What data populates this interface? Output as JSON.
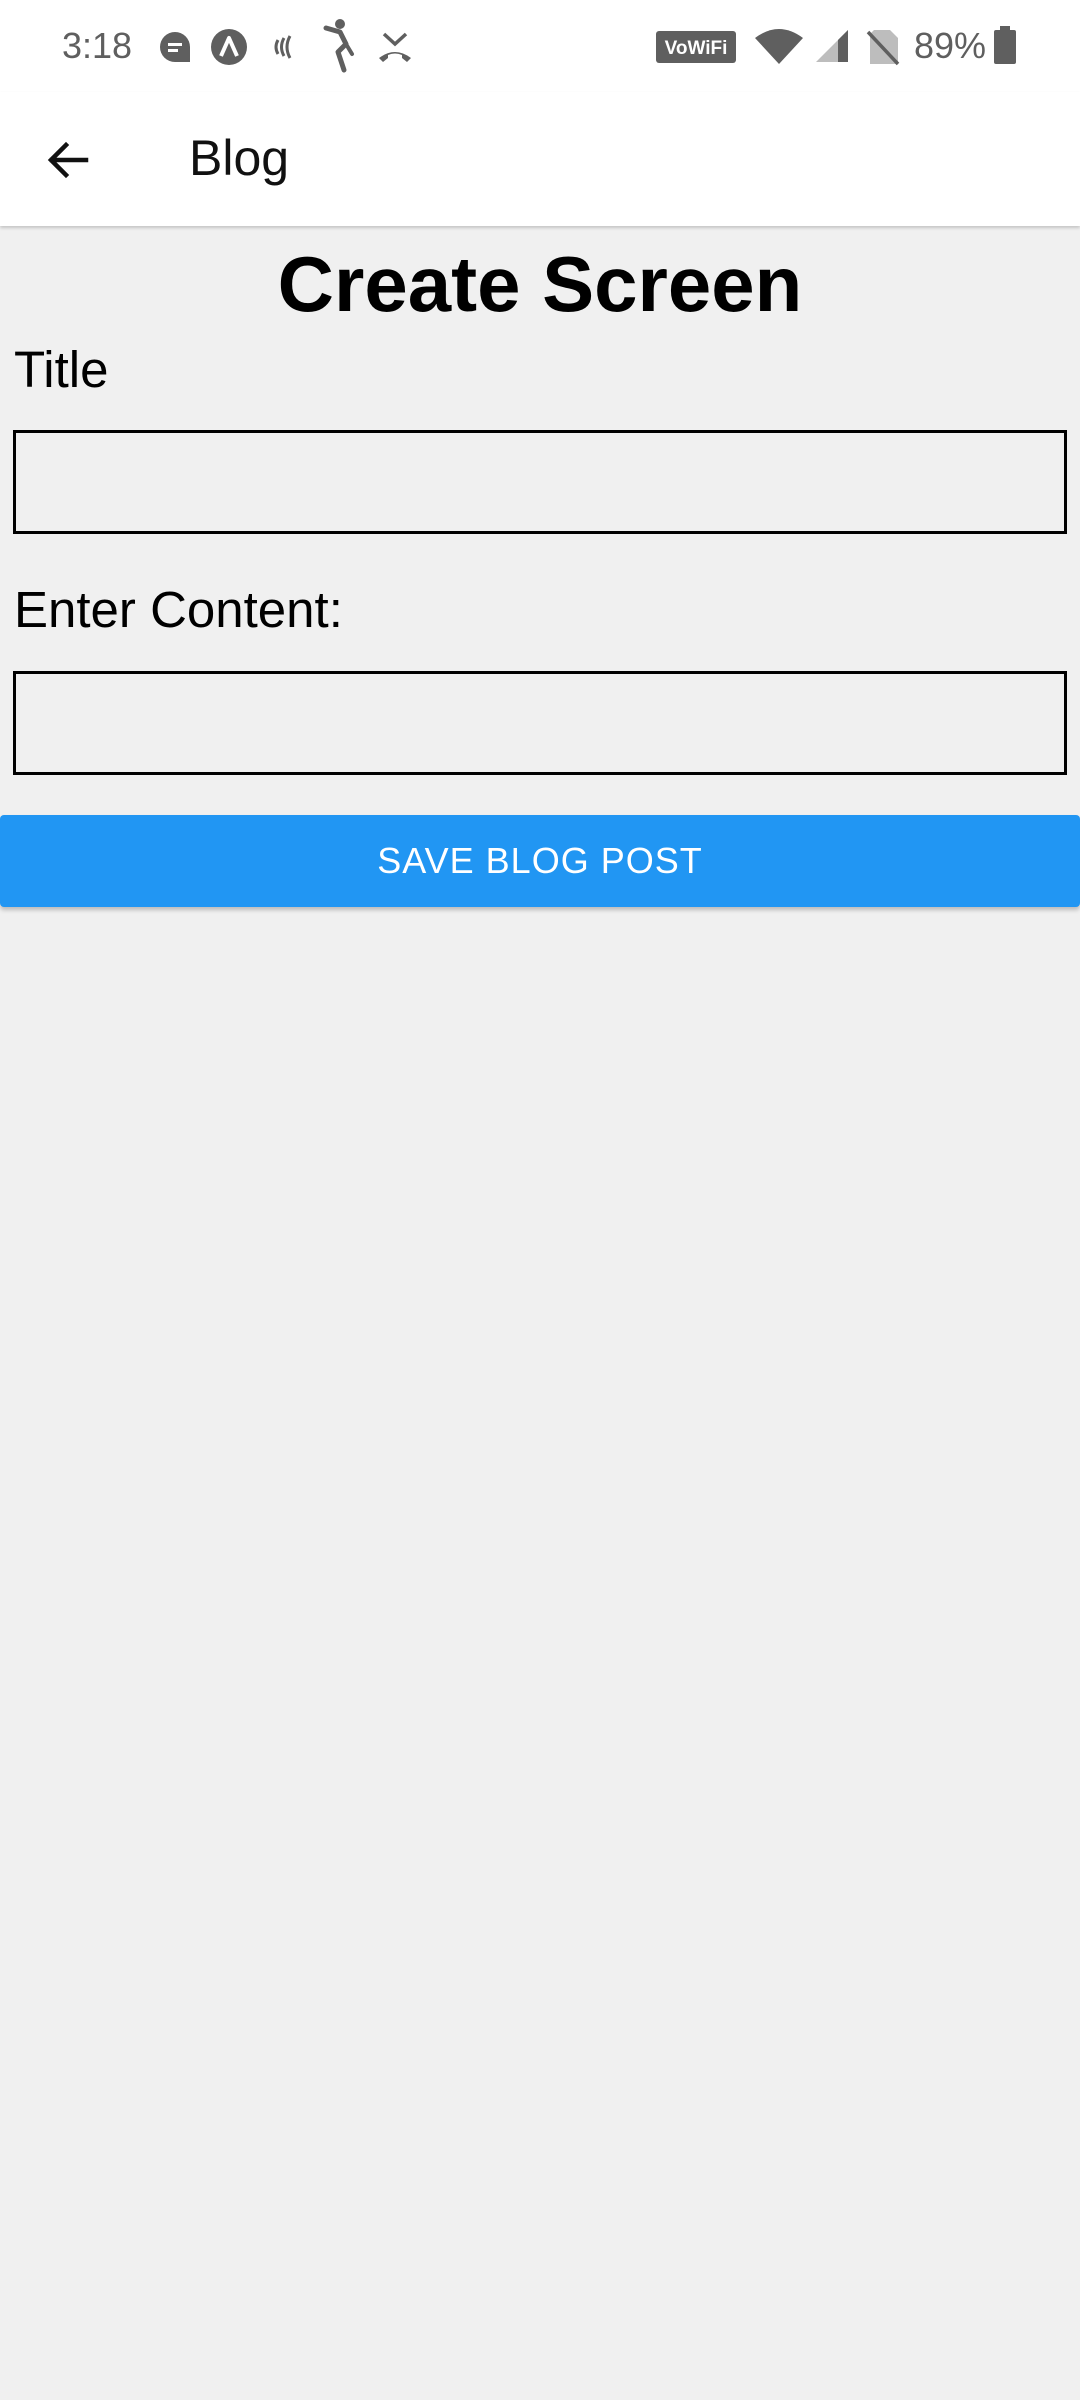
{
  "status_bar": {
    "time": "3:18",
    "battery": "89%",
    "notification_icons": [
      "chat-bubble-icon",
      "autofill-icon",
      "sound-wave-icon",
      "cricket-app-icon",
      "missed-call-icon"
    ],
    "system_icons": [
      "vowifi-icon",
      "wifi-icon",
      "cellular-signal-icon",
      "no-sim-icon",
      "battery-icon"
    ],
    "vowifi_label": "VoWiFi"
  },
  "app_bar": {
    "back_icon": "arrow-left-icon",
    "title": "Blog"
  },
  "main": {
    "heading": "Create Screen",
    "title_label": "Title",
    "title_value": "",
    "content_label": "Enter Content:",
    "content_value": "",
    "save_button_label": "SAVE BLOG POST"
  },
  "colors": {
    "accent": "#2196f3",
    "background": "#f0f0f0",
    "app_bar": "#ffffff",
    "status_text": "#5f5f5f"
  }
}
